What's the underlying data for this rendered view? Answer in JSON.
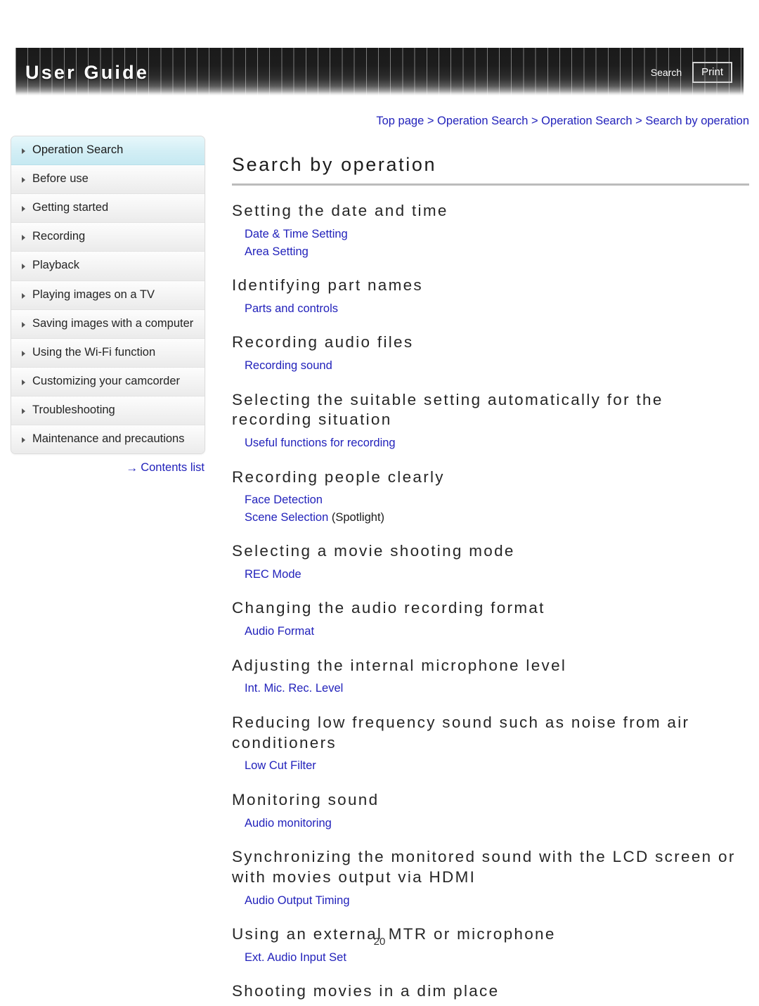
{
  "header": {
    "title": "User Guide",
    "search_label": "Search",
    "print_label": "Print"
  },
  "sidebar": {
    "items": [
      {
        "label": "Operation Search",
        "active": true
      },
      {
        "label": "Before use",
        "active": false
      },
      {
        "label": "Getting started",
        "active": false
      },
      {
        "label": "Recording",
        "active": false
      },
      {
        "label": "Playback",
        "active": false
      },
      {
        "label": "Playing images on a TV",
        "active": false
      },
      {
        "label": "Saving images with a computer",
        "active": false
      },
      {
        "label": "Using the Wi-Fi function",
        "active": false
      },
      {
        "label": "Customizing your camcorder",
        "active": false
      },
      {
        "label": "Troubleshooting",
        "active": false
      },
      {
        "label": "Maintenance and precautions",
        "active": false
      }
    ],
    "contents_link": "Contents list",
    "arrow_icon": "→"
  },
  "main": {
    "breadcrumb": "Top page > Operation Search > Operation Search > Search by operation",
    "page_title": "Search by operation",
    "sections": [
      {
        "heading": "Setting the date and time",
        "links": [
          {
            "text": "Date & Time Setting",
            "suffix": ""
          },
          {
            "text": "Area Setting",
            "suffix": ""
          }
        ]
      },
      {
        "heading": "Identifying part names",
        "links": [
          {
            "text": "Parts and controls",
            "suffix": ""
          }
        ]
      },
      {
        "heading": "Recording audio files",
        "links": [
          {
            "text": "Recording sound",
            "suffix": ""
          }
        ]
      },
      {
        "heading": "Selecting the suitable setting automatically for the recording situation",
        "links": [
          {
            "text": "Useful functions for recording",
            "suffix": ""
          }
        ]
      },
      {
        "heading": "Recording people clearly",
        "links": [
          {
            "text": "Face Detection",
            "suffix": ""
          },
          {
            "text": "Scene Selection",
            "suffix": " (Spotlight)"
          }
        ]
      },
      {
        "heading": "Selecting a movie shooting mode",
        "links": [
          {
            "text": "REC Mode",
            "suffix": ""
          }
        ]
      },
      {
        "heading": "Changing the audio recording format",
        "links": [
          {
            "text": "Audio Format",
            "suffix": ""
          }
        ]
      },
      {
        "heading": "Adjusting the internal microphone level",
        "links": [
          {
            "text": "Int. Mic. Rec. Level",
            "suffix": ""
          }
        ]
      },
      {
        "heading": "Reducing low frequency sound such as noise from air conditioners",
        "links": [
          {
            "text": "Low Cut Filter",
            "suffix": ""
          }
        ]
      },
      {
        "heading": "Monitoring sound",
        "links": [
          {
            "text": "Audio monitoring",
            "suffix": ""
          }
        ]
      },
      {
        "heading": "Synchronizing the monitored sound with the LCD screen or with movies output via HDMI",
        "links": [
          {
            "text": "Audio Output Timing",
            "suffix": ""
          }
        ]
      },
      {
        "heading": "Using an external MTR or microphone",
        "links": [
          {
            "text": "Ext. Audio Input Set",
            "suffix": ""
          }
        ]
      },
      {
        "heading": "Shooting movies in a dim place",
        "links": []
      }
    ]
  },
  "footer": {
    "page_number": "20"
  },
  "colors": {
    "link": "#2222bb",
    "heading": "#262626",
    "active_nav": "#c6e9f2",
    "header_bg": "#1a1a1a"
  }
}
